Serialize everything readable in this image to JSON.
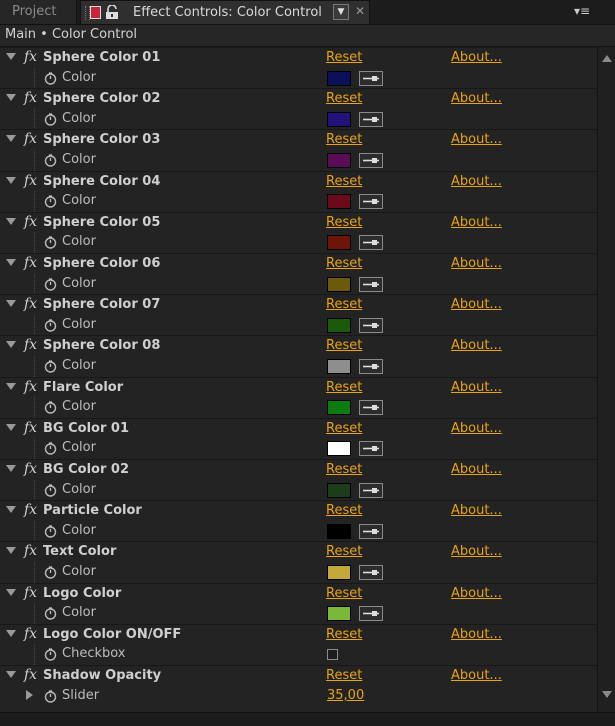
{
  "tabs": {
    "project": "Project",
    "active": "Effect Controls: Color Control"
  },
  "breadcrumb": "Main • Color Control",
  "links": {
    "reset": "Reset",
    "about": "About..."
  },
  "effects": [
    {
      "name": "Sphere Color 01",
      "prop": "Color",
      "type": "color",
      "color": "#0b1058"
    },
    {
      "name": "Sphere Color 02",
      "prop": "Color",
      "type": "color",
      "color": "#22127a"
    },
    {
      "name": "Sphere Color 03",
      "prop": "Color",
      "type": "color",
      "color": "#5a0c56"
    },
    {
      "name": "Sphere Color 04",
      "prop": "Color",
      "type": "color",
      "color": "#6a0a1a"
    },
    {
      "name": "Sphere Color 05",
      "prop": "Color",
      "type": "color",
      "color": "#6e1508"
    },
    {
      "name": "Sphere Color 06",
      "prop": "Color",
      "type": "color",
      "color": "#6b5a0a"
    },
    {
      "name": "Sphere Color 07",
      "prop": "Color",
      "type": "color",
      "color": "#1a5a0a"
    },
    {
      "name": "Sphere Color 08",
      "prop": "Color",
      "type": "color",
      "color": "#8e8e8e"
    },
    {
      "name": "Flare Color",
      "prop": "Color",
      "type": "color",
      "color": "#0e7a10"
    },
    {
      "name": "BG Color 01",
      "prop": "Color",
      "type": "color",
      "color": "#ffffff"
    },
    {
      "name": "BG Color 02",
      "prop": "Color",
      "type": "color",
      "color": "#1d3d1a"
    },
    {
      "name": "Particle Color",
      "prop": "Color",
      "type": "color",
      "color": "#000000"
    },
    {
      "name": "Text Color",
      "prop": "Color",
      "type": "color",
      "color": "#c4a83a"
    },
    {
      "name": "Logo Color",
      "prop": "Color",
      "type": "color",
      "color": "#7ab83a"
    },
    {
      "name": "Logo Color ON/OFF",
      "prop": "Checkbox",
      "type": "checkbox",
      "checked": false
    },
    {
      "name": "Shadow Opacity",
      "prop": "Slider",
      "type": "slider",
      "value": "35,00"
    }
  ]
}
